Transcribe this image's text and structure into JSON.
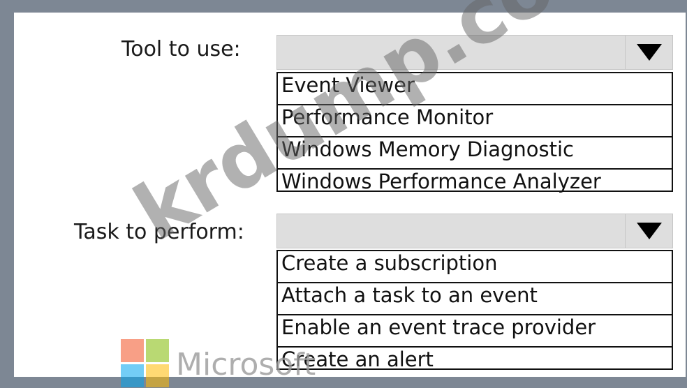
{
  "tool": {
    "label": "Tool to use:",
    "selected": "",
    "options": [
      "Event Viewer",
      "Performance Monitor",
      "Windows Memory Diagnostic",
      "Windows Performance Analyzer"
    ]
  },
  "task": {
    "label": "Task to perform:",
    "selected": "",
    "options": [
      "Create a subscription",
      "Attach a task to an event",
      "Enable an event trace provider",
      "Create an alert"
    ]
  },
  "watermark": {
    "text": "krdump.com"
  },
  "brand": {
    "text": "Microsoft",
    "logo_icon": "microsoft-logo-icon",
    "logo_colors": [
      "#f25022",
      "#7fba00",
      "#00a4ef",
      "#ffb900"
    ]
  }
}
